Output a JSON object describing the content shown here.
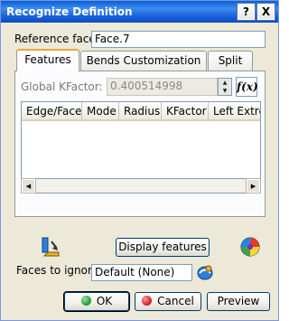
{
  "window": {
    "title": "Recognize Definition",
    "help_label": "?",
    "close_label": "X"
  },
  "reference_face": {
    "label": "Reference face",
    "value": "Face.7"
  },
  "tabs": [
    {
      "label": "Features",
      "active": true
    },
    {
      "label": "Bends Customization",
      "active": false
    },
    {
      "label": "Split",
      "active": false
    }
  ],
  "global_kfactor": {
    "label": "Global KFactor:",
    "value": "0.400514998",
    "formula_label": "f(x)"
  },
  "table": {
    "columns": [
      "Edge/Face",
      "Mode",
      "Radius",
      "KFactor",
      "Left Extre"
    ],
    "rows": []
  },
  "display_features": {
    "label": "Display features"
  },
  "faces_to_ignore": {
    "label": "Faces to ignore",
    "value": "Default (None)"
  },
  "buttons": {
    "ok": "OK",
    "cancel": "Cancel",
    "preview": "Preview"
  },
  "colors": {
    "title_bar": "#0a5fd6",
    "dialog_bg": "#ece9d8",
    "ok_dot": "#2ea043",
    "cancel_dot": "#d9262f",
    "tab_highlight": "#f2a33a"
  },
  "icons": {
    "title_help": "question-mark-icon",
    "title_close": "close-icon",
    "formula": "function-fx-icon",
    "bend_tool": "bend-select-icon",
    "color_wheel": "color-wheel-icon",
    "faces_selector": "face-selection-icon"
  }
}
